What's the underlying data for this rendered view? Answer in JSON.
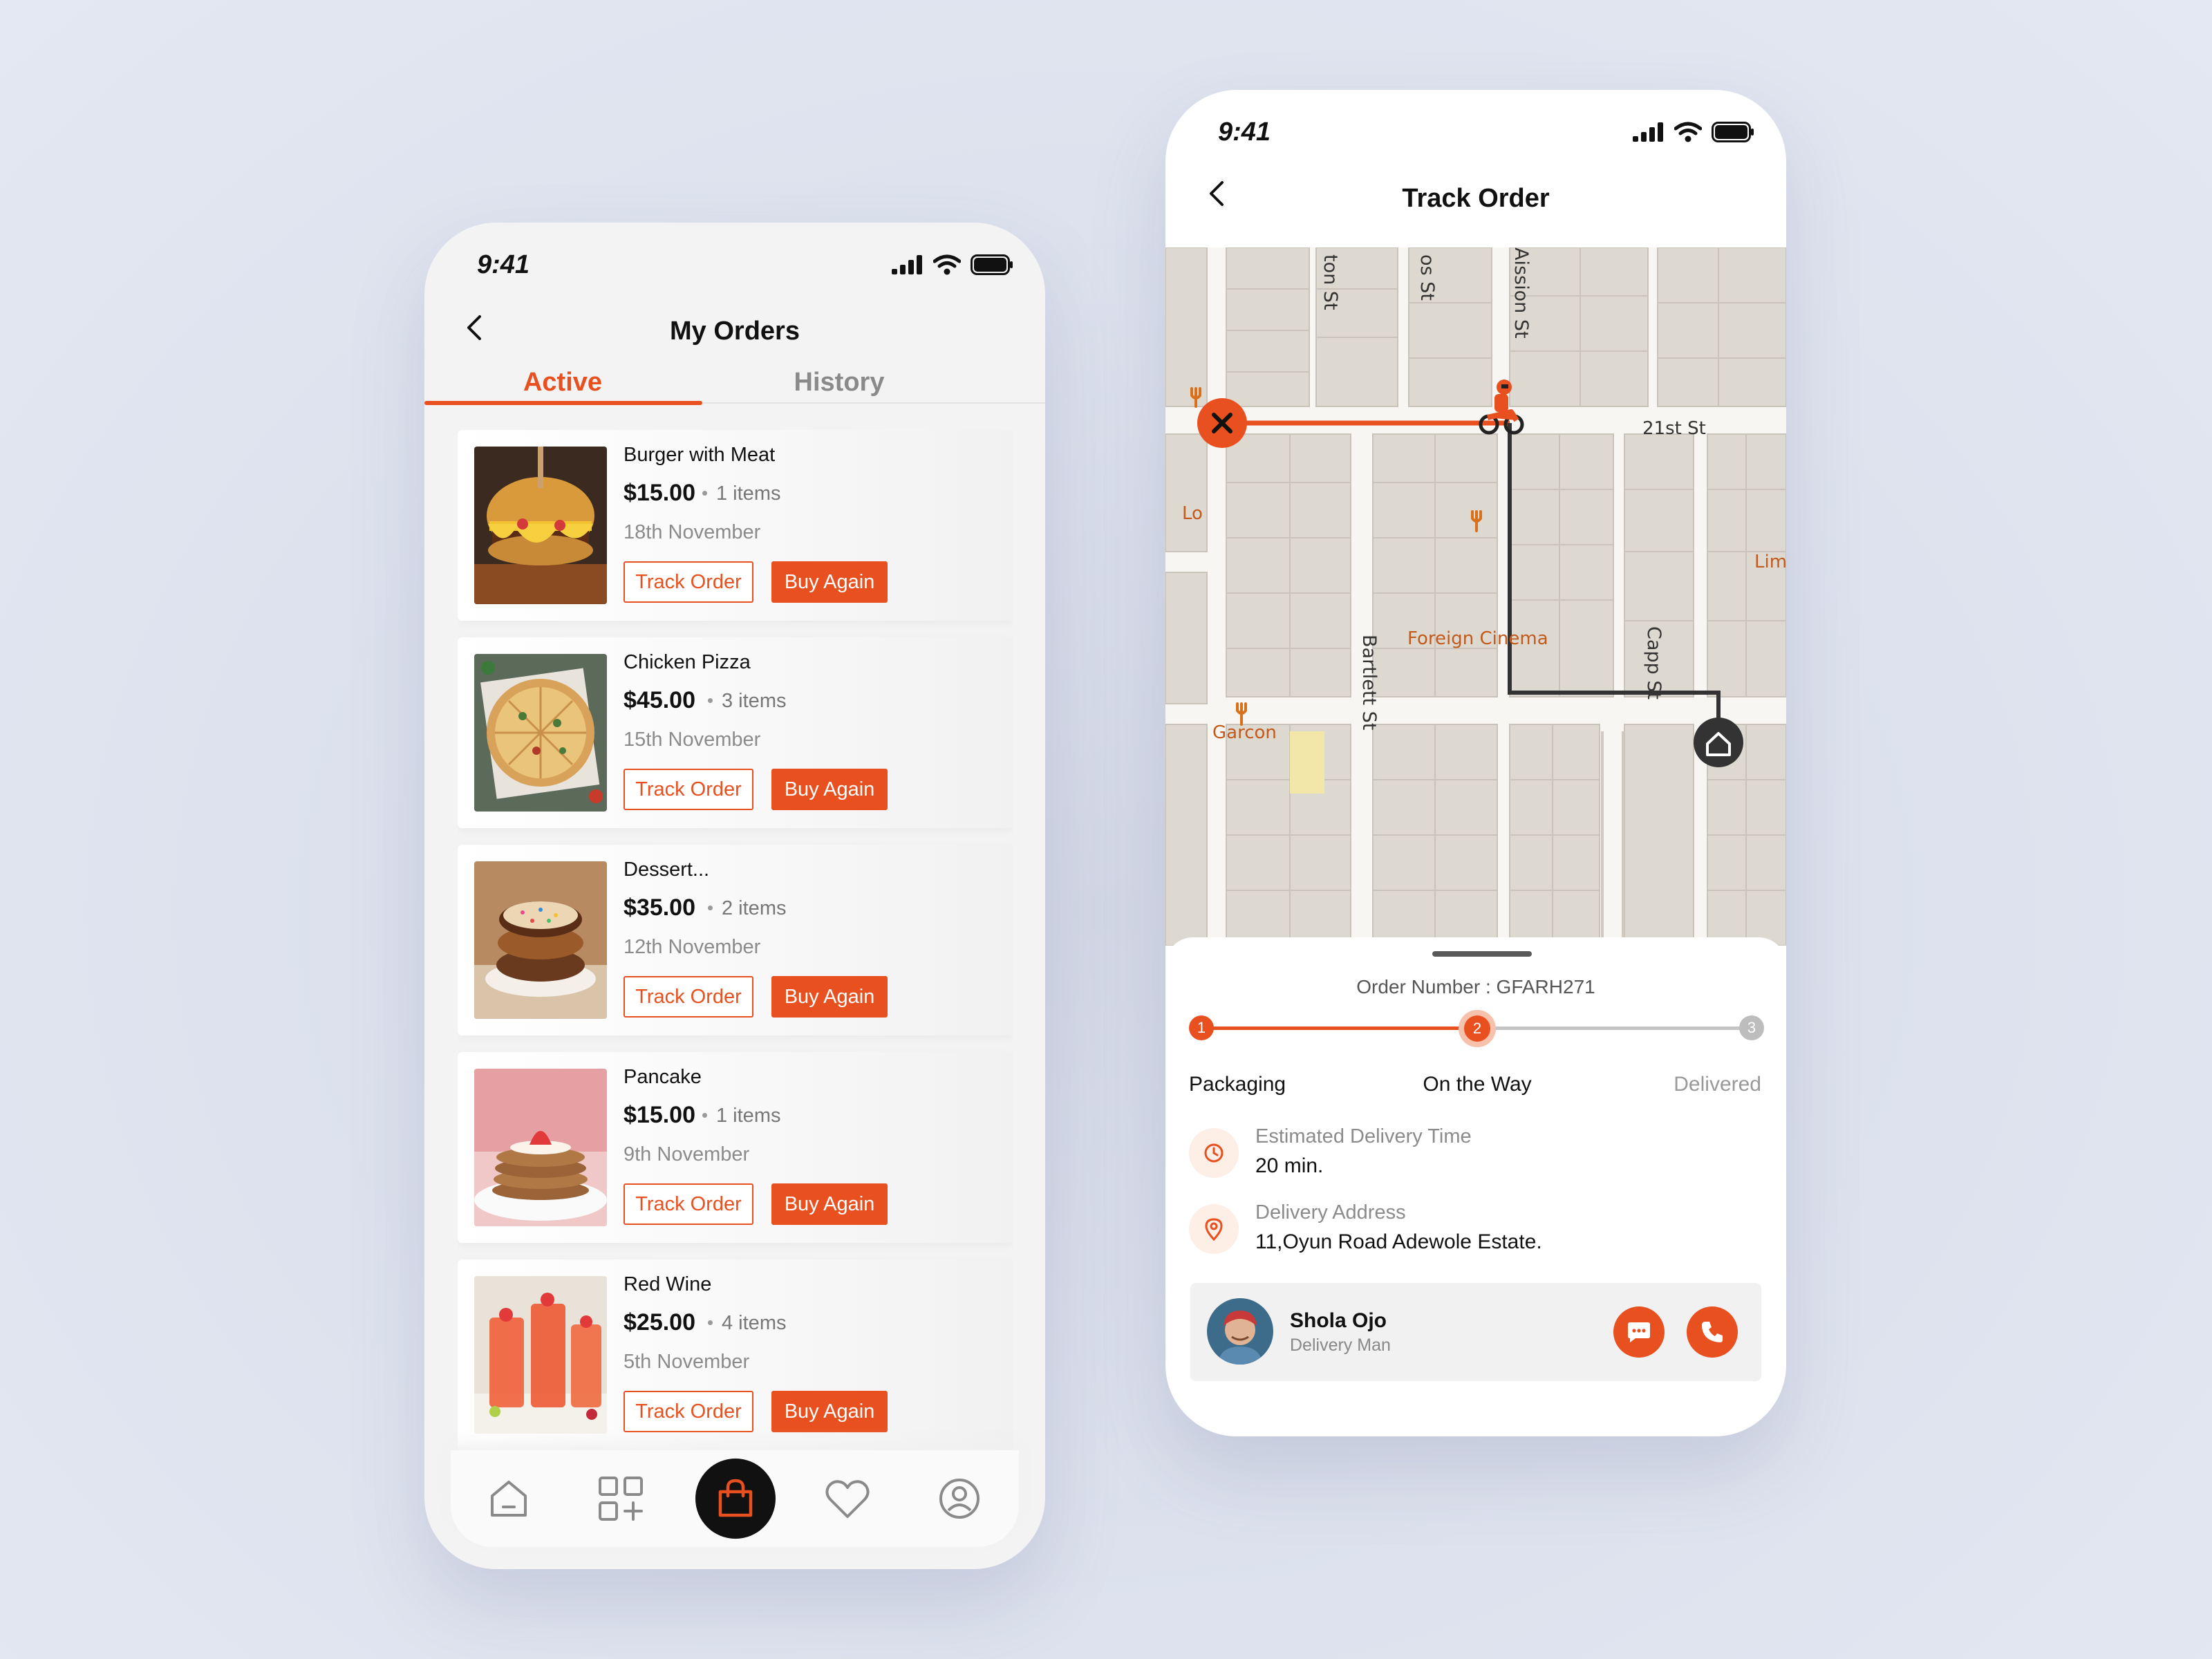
{
  "colors": {
    "accent": "#e8501f",
    "background": "#dde2ee",
    "dark": "#111111"
  },
  "orders_screen": {
    "status_time": "9:41",
    "title": "My Orders",
    "tabs": [
      {
        "label": "Active",
        "selected": true
      },
      {
        "label": "History",
        "selected": false
      }
    ],
    "orders": [
      {
        "name": "Burger with Meat",
        "price": "$15.00",
        "items": "1 items",
        "date": "18th November",
        "track_label": "Track Order",
        "buy_label": "Buy Again"
      },
      {
        "name": "Chicken Pizza",
        "price": "$45.00",
        "items": "3 items",
        "date": "15th November",
        "track_label": "Track Order",
        "buy_label": "Buy Again"
      },
      {
        "name": "Dessert...",
        "price": "$35.00",
        "items": "2 items",
        "date": "12th November",
        "track_label": "Track Order",
        "buy_label": "Buy Again"
      },
      {
        "name": "Pancake",
        "price": "$15.00",
        "items": "1 items",
        "date": "9th November",
        "track_label": "Track Order",
        "buy_label": "Buy Again"
      },
      {
        "name": "Red Wine",
        "price": "$25.00",
        "items": "4 items",
        "date": "5th November",
        "track_label": "Track Order",
        "buy_label": "Buy Again"
      }
    ],
    "bottom_nav": [
      "home-icon",
      "grid-add-icon",
      "shopping-bag-icon",
      "heart-icon",
      "profile-icon"
    ],
    "bottom_nav_active": "shopping-bag-icon"
  },
  "track_screen": {
    "status_time": "9:41",
    "title": "Track Order",
    "map_labels": {
      "street_top_1": "ton St",
      "street_top_2": "os St",
      "street_mission": "Aission St",
      "street_21st": "21st St",
      "street_bartlett": "Bartlett St",
      "street_capp": "Capp St",
      "poi_foreign_cinema": "Foreign Cinema",
      "poi_garcon": "Garcon",
      "poi_lim": "Lim",
      "poi_lo": "Lo"
    },
    "order_number": "Order Number : GFARH271",
    "steps": [
      {
        "num": "1",
        "label": "Packaging",
        "state": "done"
      },
      {
        "num": "2",
        "label": "On the Way",
        "state": "current"
      },
      {
        "num": "3",
        "label": "Delivered",
        "state": "pending"
      }
    ],
    "progress": 0.5,
    "eta": {
      "label": "Estimated Delivery Time",
      "value": "20 min."
    },
    "address": {
      "label": "Delivery Address",
      "value": "11,Oyun Road Adewole Estate."
    },
    "driver": {
      "name": "Shola Ojo",
      "role": "Delivery Man"
    }
  }
}
